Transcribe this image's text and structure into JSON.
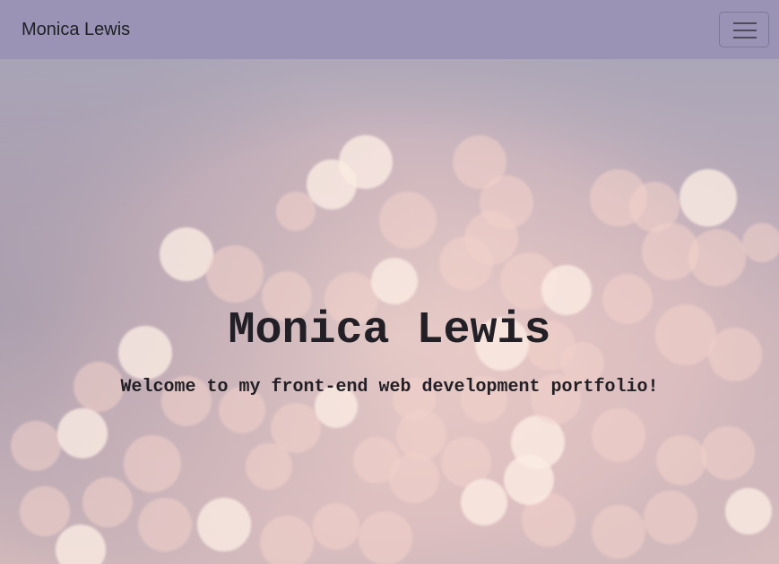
{
  "navbar": {
    "brand": "Monica Lewis",
    "toggler_icon": "hamburger-menu-icon",
    "background_color": "#9a93b6"
  },
  "hero": {
    "title": "Monica Lewis",
    "subtitle": "Welcome to my front-end web development portfolio!",
    "background": "pink bokeh lights",
    "text_color": "#222026"
  }
}
